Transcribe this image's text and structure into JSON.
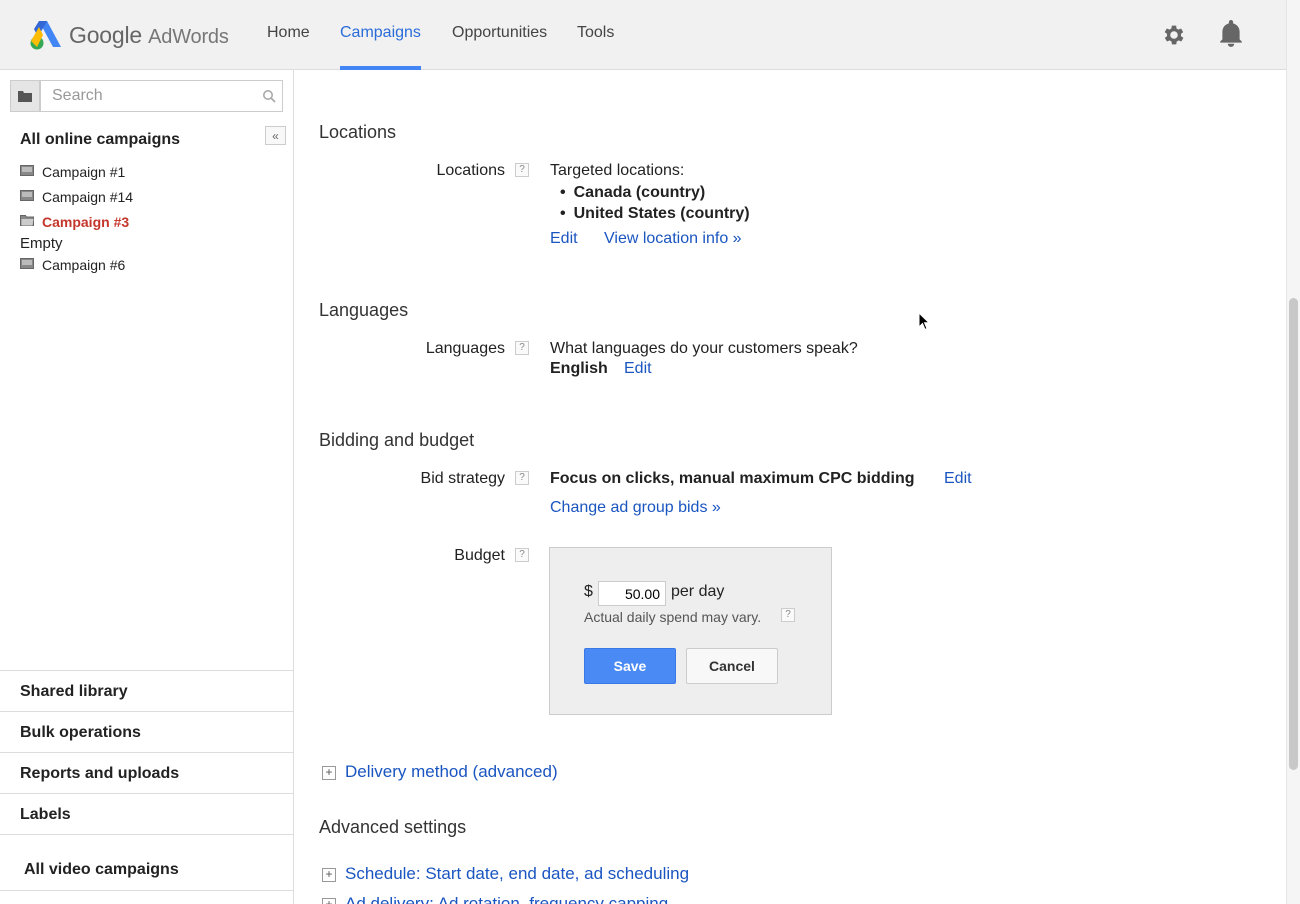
{
  "header": {
    "logo_text": "Google",
    "logo_product": "AdWords",
    "nav": [
      {
        "label": "Home"
      },
      {
        "label": "Campaigns"
      },
      {
        "label": "Opportunities"
      },
      {
        "label": "Tools"
      }
    ],
    "active_nav": "Campaigns"
  },
  "sidebar": {
    "search_placeholder": "Search",
    "all_online_label": "All online campaigns",
    "campaigns": [
      {
        "label": "Campaign #1"
      },
      {
        "label": "Campaign #14"
      },
      {
        "label": "Campaign #3"
      },
      {
        "label": "Campaign #6"
      }
    ],
    "selected_campaign": "Campaign #3",
    "empty_label": "Empty",
    "sections": [
      "Shared library",
      "Bulk operations",
      "Reports and uploads",
      "Labels"
    ],
    "all_video_label": "All video campaigns"
  },
  "main": {
    "locations": {
      "section_title": "Locations",
      "label": "Locations",
      "help": "?",
      "intro": "Targeted locations:",
      "items": [
        "Canada (country)",
        "United States (country)"
      ],
      "edit_link": "Edit",
      "view_link": "View location info »"
    },
    "languages": {
      "section_title": "Languages",
      "label": "Languages",
      "help": "?",
      "question": "What languages do your customers speak?",
      "value": "English",
      "edit_link": "Edit"
    },
    "bidding": {
      "section_title": "Bidding and budget",
      "bid_label": "Bid strategy",
      "help": "?",
      "bid_value": "Focus on clicks, manual maximum CPC bidding",
      "bid_edit": "Edit",
      "change_bids_link": "Change ad group bids »",
      "budget_label": "Budget",
      "currency": "$",
      "budget_value": "50.00",
      "per_day": "per day",
      "note": "Actual daily spend may vary.",
      "save_label": "Save",
      "cancel_label": "Cancel"
    },
    "delivery_link": "Delivery method (advanced)",
    "advanced": {
      "section_title": "Advanced settings",
      "schedule_link": "Schedule: Start date, end date, ad scheduling",
      "ad_delivery_link": "Ad delivery: Ad rotation, frequency capping"
    }
  }
}
